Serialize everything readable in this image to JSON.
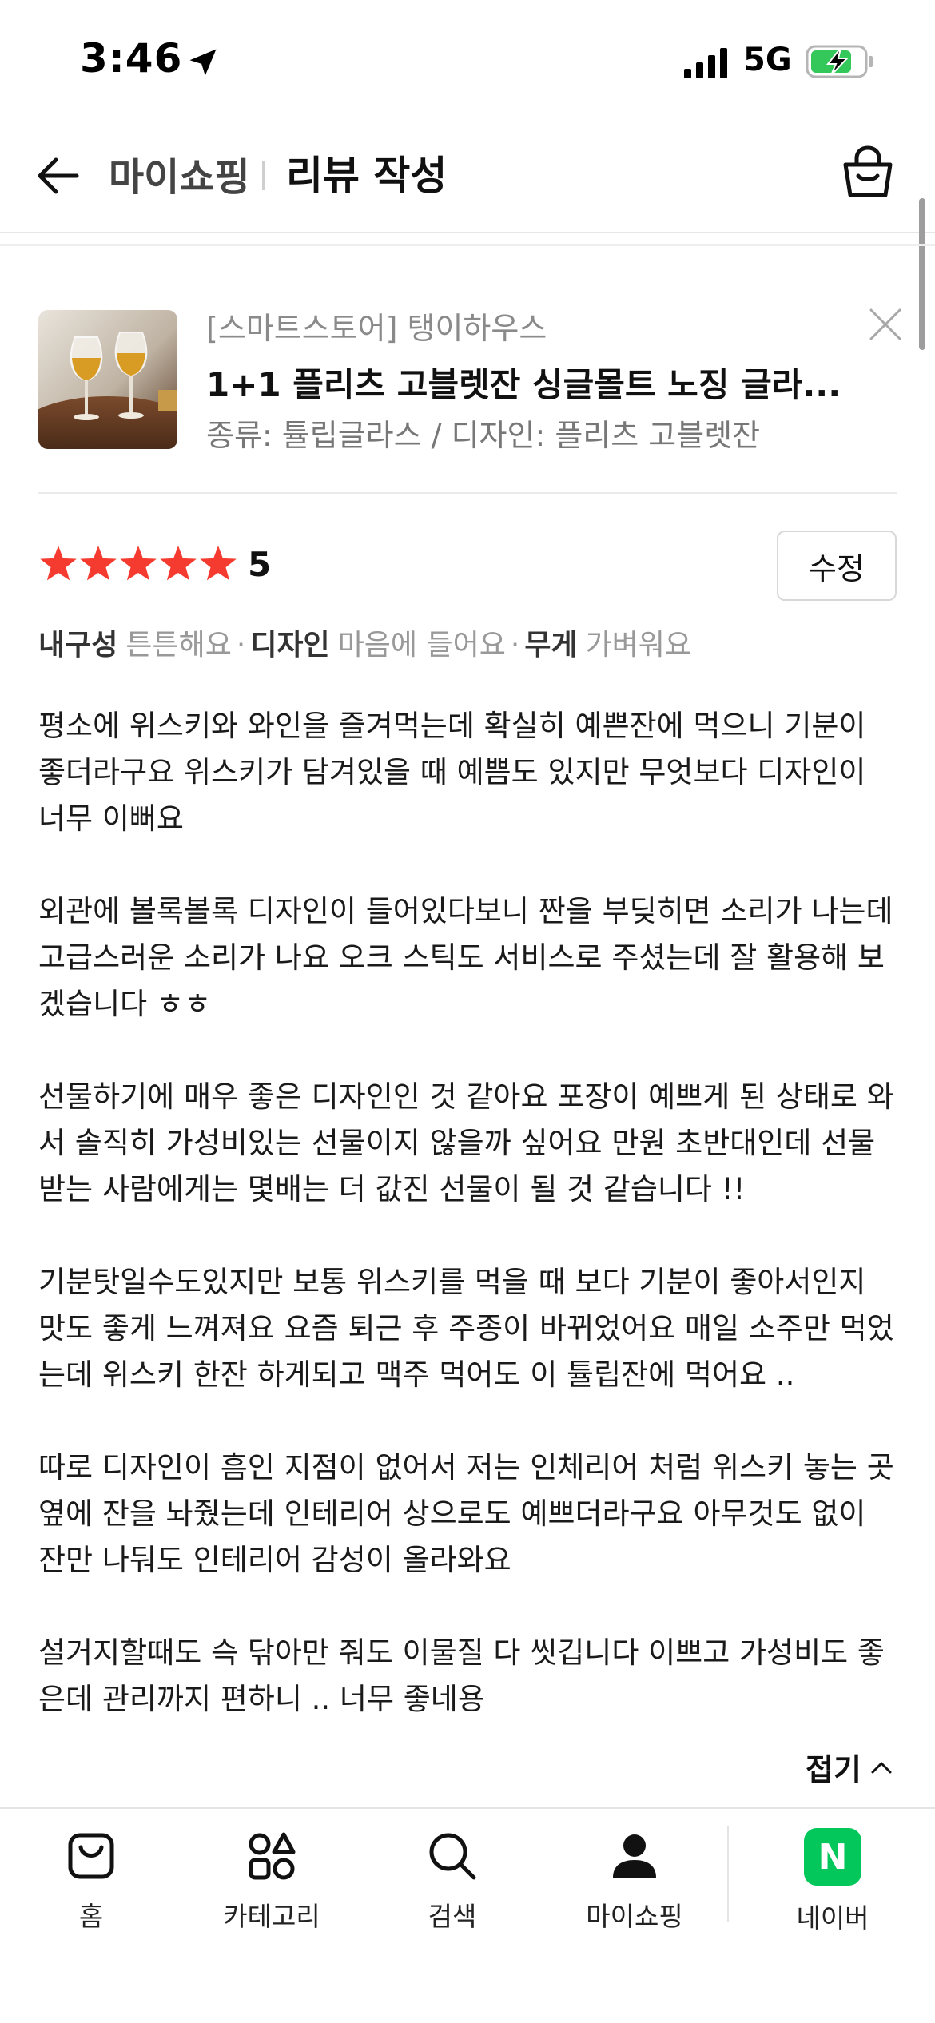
{
  "status_bar": {
    "time": "3:46",
    "network": "5G"
  },
  "header": {
    "breadcrumb_parent": "마이쇼핑",
    "title": "리뷰 작성",
    "icons": [
      "arrow-left-icon",
      "shopping-bag-icon"
    ]
  },
  "product": {
    "store": "[스마트스토어] 탱이하우스",
    "name": "1+1 플리츠 고블렛잔 싱글몰트 노징 글라...",
    "option": "종류: 튤립글라스 / 디자인: 플리츠 고블렛잔"
  },
  "rating": {
    "stars": 5,
    "max": 5,
    "score_label": "5",
    "edit_label": "수정",
    "star_color": "#f53b2f"
  },
  "attributes": [
    {
      "key": "내구성",
      "value": "튼튼해요"
    },
    {
      "key": "디자인",
      "value": "마음에 들어요"
    },
    {
      "key": "무게",
      "value": "가벼워요"
    }
  ],
  "attr_separator": "·",
  "review_paragraphs": [
    "평소에 위스키와 와인을 즐겨먹는데 확실히 예쁜잔에 먹으니 기분이 좋더라구요 위스키가 담겨있을 때 예쁨도 있지만 무엇보다 디자인이 너무 이뻐요",
    "외관에 볼록볼록 디자인이 들어있다보니 짠을 부딪히면 소리가 나는데 고급스러운 소리가 나요 오크 스틱도 서비스로 주셨는데 잘 활용해 보겠습니다 ㅎㅎ",
    "선물하기에 매우 좋은 디자인인 것 같아요 포장이 예쁘게 된 상태로 와서 솔직히 가성비있는 선물이지 않을까 싶어요 만원 초반대인데 선물 받는 사람에게는 몇배는 더 값진 선물이 될 것 같습니다 !!",
    "기분탓일수도있지만 보통 위스키를 먹을 때 보다 기분이 좋아서인지 맛도 좋게 느껴져요 요즘 퇴근 후 주종이 바뀌었어요 매일 소주만 먹었는데 위스키 한잔 하게되고 맥주 먹어도 이 튤립잔에 먹어요 ..",
    "따로 디자인이 흠인 지점이 없어서 저는 인체리어 처럼 위스키 놓는 곳 옆에 잔을 놔줬는데 인테리어 상으로도 예쁘더라구요 아무것도 없이 잔만 나둬도 인테리어 감성이 올라와요",
    "설거지할때도 슥 닦아만 줘도 이물질 다 씻깁니다 이쁘고 가성비도 좋은데 관리까지 편하니 .. 너무 좋네용"
  ],
  "collapse_label": "접기",
  "bottom_nav": [
    {
      "label": "홈",
      "icon": "home-bag-icon"
    },
    {
      "label": "카테고리",
      "icon": "category-icon"
    },
    {
      "label": "검색",
      "icon": "search-icon"
    },
    {
      "label": "마이쇼핑",
      "icon": "person-icon"
    },
    {
      "label": "네이버",
      "icon": "naver-icon",
      "badge": "N",
      "badge_color": "#03c75a"
    }
  ]
}
